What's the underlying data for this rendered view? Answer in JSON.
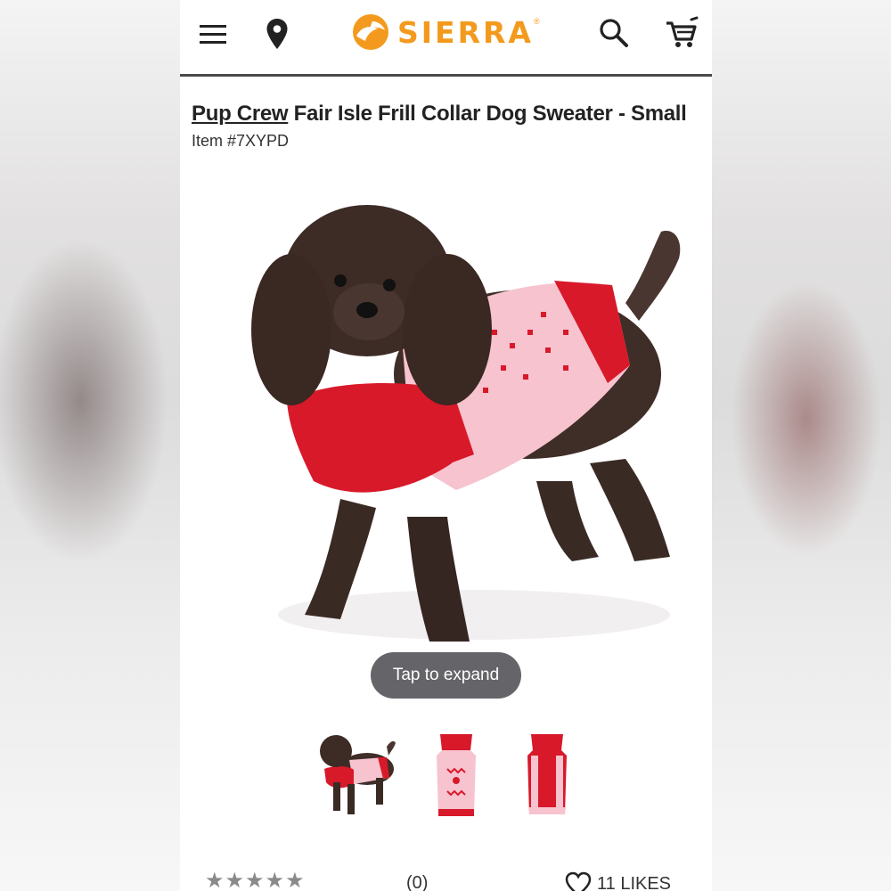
{
  "header": {
    "menu_icon": "hamburger-menu-icon",
    "location_icon": "map-pin-icon",
    "logo_text": "SIERRA",
    "logo_reg": "®",
    "search_icon": "search-icon",
    "cart_icon": "shopping-cart-icon",
    "brand_color": "#f39a1e"
  },
  "product": {
    "brand": "Pup Crew",
    "name": " Fair Isle Frill Collar Dog Sweater - Small",
    "item_number": "Item #7XYPD"
  },
  "gallery": {
    "expand_label": "Tap to expand",
    "thumbnails": [
      "dog-wearing-sweater",
      "sweater-front",
      "sweater-back"
    ]
  },
  "reviews": {
    "stars": "★★★★★",
    "count": "(0)",
    "likes": "11 LIKES"
  },
  "colors": {
    "sweater_red": "#d8192a",
    "sweater_pink": "#f6c3cf",
    "header_divider": "#4a4a4a"
  }
}
